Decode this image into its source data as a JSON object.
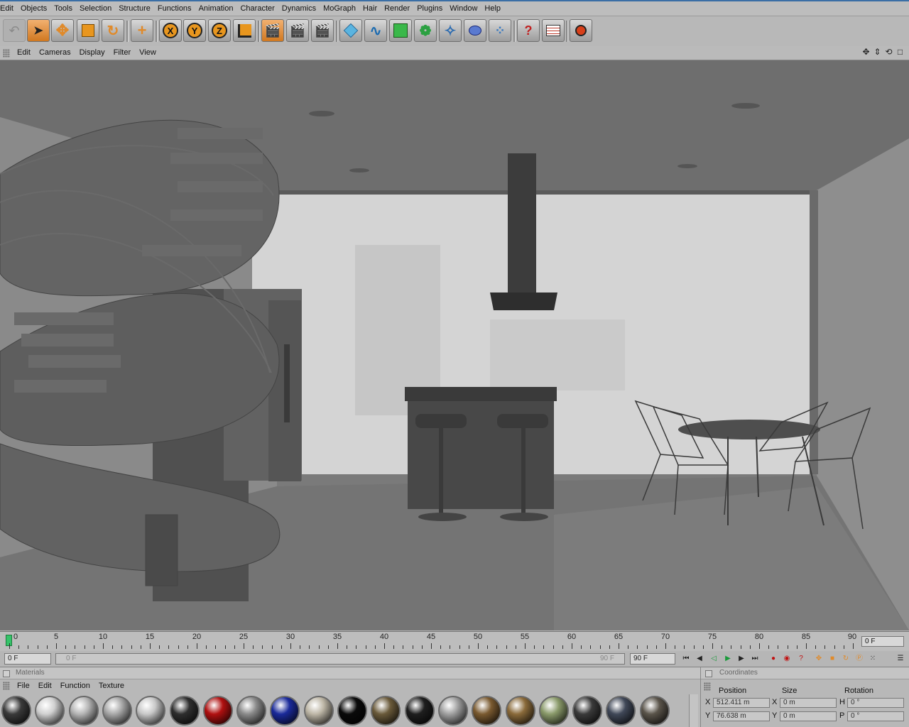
{
  "menubar": {
    "items": [
      "Edit",
      "Objects",
      "Tools",
      "Selection",
      "Structure",
      "Functions",
      "Animation",
      "Character",
      "Dynamics",
      "MoGraph",
      "Hair",
      "Render",
      "Plugins",
      "Window",
      "Help"
    ]
  },
  "toolbar": {
    "axis_x": "X",
    "axis_y": "Y",
    "axis_z": "Z"
  },
  "viewport_menu": {
    "items": [
      "Edit",
      "Cameras",
      "Display",
      "Filter",
      "View"
    ]
  },
  "timeline": {
    "ticks": [
      "0",
      "5",
      "10",
      "15",
      "20",
      "25",
      "30",
      "35",
      "40",
      "45",
      "50",
      "55",
      "60",
      "65",
      "70",
      "75",
      "80",
      "85",
      "90"
    ],
    "current_frame": "0 F",
    "start_frame": "0 F",
    "slider_start": "0 F",
    "slider_end": "90 F",
    "end_frame": "90 F"
  },
  "materials": {
    "title": "Materials",
    "menu": [
      "File",
      "Edit",
      "Function",
      "Texture"
    ],
    "swatch_colors": [
      "#3a3a3a",
      "#d0d0d0",
      "#b5b5b5",
      "#a8a8a8",
      "#c8c8c8",
      "#2e2e2e",
      "#b01010",
      "#8a8a8a",
      "#1a2a9a",
      "#bdb6a6",
      "#0a0a0a",
      "#6a5a3a",
      "#1e1e1e",
      "#a0a0a0",
      "#7a5a30",
      "#8a6a3a",
      "#8a9a6a",
      "#3a3a3a",
      "#404858",
      "#5a544a"
    ]
  },
  "coordinates": {
    "title": "Coordinates",
    "headers": {
      "position": "Position",
      "size": "Size",
      "rotation": "Rotation"
    },
    "rows": [
      {
        "axis": "X",
        "position": "512.411 m",
        "size_axis": "X",
        "size": "0 m",
        "rot_axis": "H",
        "rotation": "0 °"
      },
      {
        "axis": "Y",
        "position": "76.638 m",
        "size_axis": "Y",
        "size": "0 m",
        "rot_axis": "P",
        "rotation": "0 °"
      }
    ]
  },
  "colors": {
    "accent_orange": "#e08a2a",
    "playhead_green": "#36c36a",
    "menu_bg": "#bdbdbd"
  }
}
